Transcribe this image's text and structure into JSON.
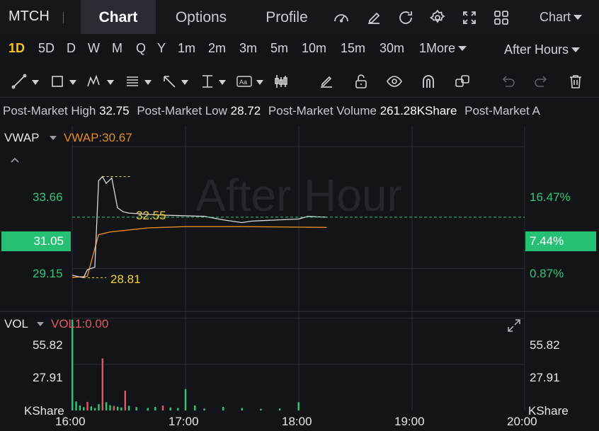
{
  "header": {
    "ticker": "MTCH",
    "tabs": [
      {
        "label": "Chart",
        "active": true
      },
      {
        "label": "Options",
        "active": false
      },
      {
        "label": "Profile",
        "active": false
      }
    ],
    "icons": [
      "gauge-icon",
      "edit-icon",
      "refresh-icon",
      "settings-icon",
      "fullscreen-icon",
      "grid-icon"
    ],
    "chart_menu": "Chart"
  },
  "periods": {
    "items": [
      "1D",
      "5D",
      "D",
      "W",
      "M",
      "Q",
      "Y",
      "1m",
      "2m",
      "3m",
      "5m",
      "10m",
      "15m",
      "30m",
      "1More"
    ],
    "active": "1D",
    "session": "After Hours"
  },
  "toolbar": {
    "tools": [
      "line-tool-icon",
      "rectangle-tool-icon",
      "pattern-tool-icon",
      "fib-tool-icon",
      "arrow-tool-icon",
      "measure-tool-icon",
      "text-tool-icon",
      "candle-type-icon",
      "pencil-icon",
      "unlock-icon",
      "eye-icon",
      "magnet-icon",
      "copy-icon",
      "undo-icon",
      "redo-icon",
      "trash-icon"
    ]
  },
  "post_market": {
    "high_label": "Post-Market High",
    "high_value": "32.75",
    "low_label": "Post-Market Low",
    "low_value": "28.72",
    "volume_label": "Post-Market Volume",
    "volume_value": "261.28KShare",
    "trailing": "Post-Market A"
  },
  "price_panel": {
    "indicator": "VWAP",
    "indicator_value": "VWAP:30.67",
    "watermark": "After Hour",
    "y_labels_left": [
      "33.66",
      "29.15"
    ],
    "y_labels_right": [
      "16.47%",
      "0.87%"
    ],
    "current_price": "31.05",
    "current_pct": "7.44%",
    "max_label": "32.55",
    "min_label": "28.81"
  },
  "volume_panel": {
    "indicator": "VOL",
    "indicator_value": "VOL1:0.00",
    "y_labels_left": [
      "55.82",
      "27.91"
    ],
    "y_labels_right": [
      "55.82",
      "27.91"
    ],
    "unit_left": "KShare",
    "unit_right": "KShare"
  },
  "x_axis": [
    "16:00",
    "17:00",
    "18:00",
    "19:00",
    "20:00"
  ],
  "colors": {
    "up": "#2fc67a",
    "down": "#e2585c",
    "vwap": "#e58b1f",
    "price": "#d8d9dc",
    "highlight": "#f5c518"
  },
  "chart_data": {
    "type": "line",
    "x_range": [
      "16:00",
      "20:00"
    ],
    "price_series": {
      "name": "Price",
      "x": [
        "16:00",
        "16:03",
        "16:06",
        "16:08",
        "16:10",
        "16:12",
        "16:14",
        "16:16",
        "16:18",
        "16:21",
        "16:24",
        "16:27",
        "16:30",
        "16:35",
        "16:40",
        "16:50",
        "17:00",
        "17:10",
        "17:20",
        "17:30",
        "17:35",
        "17:40",
        "17:50",
        "18:00",
        "18:05",
        "18:10",
        "18:15"
      ],
      "y": [
        28.9,
        28.85,
        28.81,
        29.1,
        29.15,
        29.2,
        32.4,
        32.55,
        32.3,
        32.5,
        31.4,
        31.25,
        31.2,
        31.18,
        31.15,
        31.12,
        31.1,
        31.08,
        30.95,
        30.85,
        30.9,
        30.92,
        30.95,
        30.98,
        31.08,
        31.06,
        31.05
      ]
    },
    "vwap_series": {
      "name": "VWAP",
      "x": [
        "16:00",
        "16:08",
        "16:14",
        "16:20",
        "16:40",
        "17:00",
        "17:30",
        "18:00",
        "18:15"
      ],
      "y": [
        28.82,
        28.86,
        30.4,
        30.5,
        30.65,
        30.7,
        30.7,
        30.68,
        30.67
      ]
    },
    "volume": {
      "x": [
        "16:00",
        "16:02",
        "16:04",
        "16:06",
        "16:08",
        "16:10",
        "16:12",
        "16:14",
        "16:16",
        "16:18",
        "16:20",
        "16:22",
        "16:24",
        "16:26",
        "16:28",
        "16:30",
        "16:34",
        "16:40",
        "16:44",
        "16:48",
        "16:52",
        "16:56",
        "17:00",
        "17:05",
        "17:10",
        "17:20",
        "17:30",
        "17:40",
        "17:50",
        "18:00"
      ],
      "values": [
        55.0,
        5.5,
        3.0,
        2.0,
        5.2,
        2.5,
        1.5,
        3.8,
        31.5,
        5.0,
        3.2,
        2.8,
        2.3,
        1.8,
        12.0,
        2.8,
        2.0,
        1.5,
        2.2,
        3.0,
        1.8,
        1.5,
        13.0,
        3.0,
        1.2,
        2.2,
        1.5,
        1.0,
        1.2,
        5.0
      ],
      "direction": [
        "up",
        "up",
        "up",
        "up",
        "down",
        "up",
        "up",
        "up",
        "down",
        "up",
        "up",
        "down",
        "up",
        "up",
        "down",
        "up",
        "up",
        "up",
        "up",
        "down",
        "up",
        "up",
        "up",
        "up",
        "up",
        "up",
        "up",
        "up",
        "up",
        "up"
      ]
    },
    "price_ylim": [
      28.4,
      33.9
    ],
    "volume_ylim": [
      0,
      60
    ],
    "grid": true
  }
}
